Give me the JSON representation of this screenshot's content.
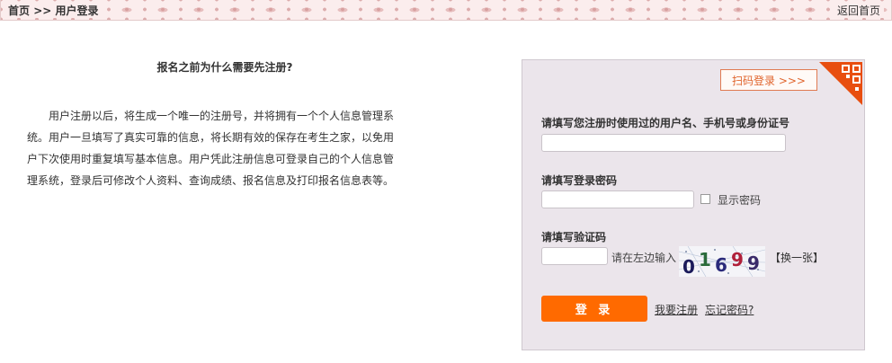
{
  "breadcrumb": {
    "home": "首页",
    "separator": ">>",
    "current": "用户登录"
  },
  "header": {
    "back_home": "返回首页"
  },
  "intro": {
    "title": "报名之前为什么需要先注册?",
    "body": "用户注册以后，将生成一个唯一的注册号，并将拥有一个个人信息管理系统。用户一旦填写了真实可靠的信息，将长期有效的保存在考生之家，以免用户下次使用时重复填写基本信息。用户凭此注册信息可登录自己的个人信息管理系统，登录后可修改个人资料、查询成绩、报名信息及打印报名信息表等。"
  },
  "login": {
    "qr_login": "扫码登录 >>>",
    "qr_icon": "qr-code-corner",
    "username_label": "请填写您注册时使用过的用户名、手机号或身份证号",
    "username_value": "",
    "password_label": "请填写登录密码",
    "password_value": "",
    "show_password": "显示密码",
    "captcha_label": "请填写验证码",
    "captcha_value": "",
    "captcha_hint": "请在左边输入",
    "captcha_text": [
      "0",
      "1",
      "6",
      "9",
      "9"
    ],
    "refresh": "【换一张】",
    "submit": "登 录",
    "register": "我要注册",
    "forgot": "忘记密码?"
  },
  "colors": {
    "accent": "#ff6a00",
    "panel_bg": "#ebe5eb",
    "topbar_bg": "#fbeded"
  }
}
